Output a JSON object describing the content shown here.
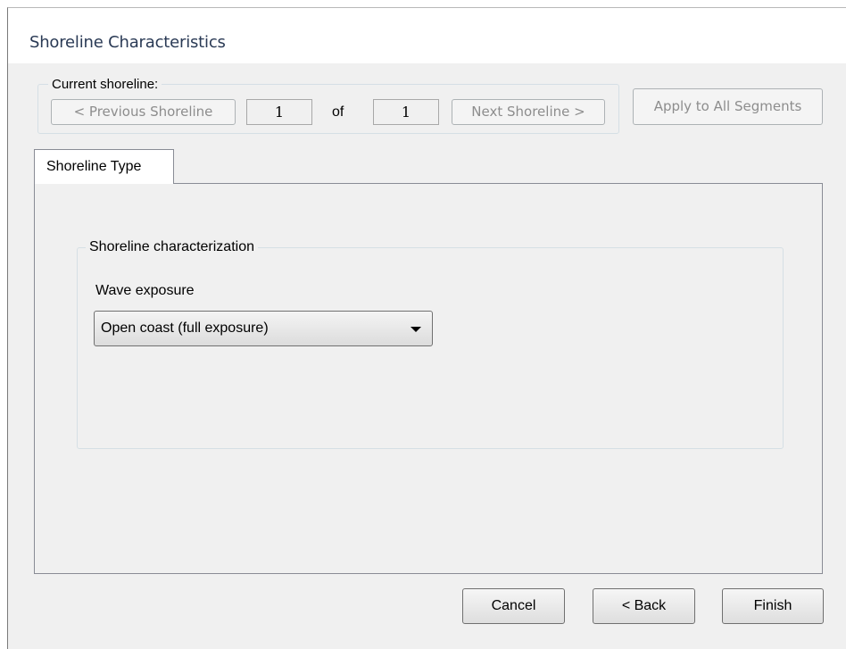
{
  "window": {
    "title": "Shoreline Characteristics"
  },
  "navigation": {
    "group_label": "Current shoreline:",
    "previous_label": "< Previous Shoreline",
    "current_index": "1",
    "of_label": "of",
    "total_count": "1",
    "next_label": "Next Shoreline >",
    "apply_all_label": "Apply to All Segments"
  },
  "tabs": [
    {
      "label": "Shoreline Type",
      "selected": true
    }
  ],
  "characterization": {
    "group_label": "Shoreline characterization",
    "wave_exposure_label": "Wave exposure",
    "wave_exposure_value": "Open coast (full exposure)"
  },
  "footer": {
    "cancel_label": "Cancel",
    "back_label": "< Back",
    "finish_label": "Finish"
  },
  "colors": {
    "window_bg": "#f0f0f0",
    "title_text": "#2a3a55",
    "disabled_text": "#8d8d8d"
  }
}
